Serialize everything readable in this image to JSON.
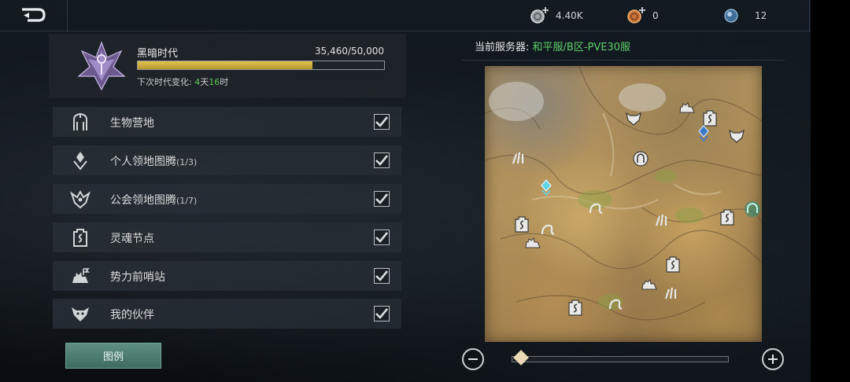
{
  "top_bar": {
    "back_icon": "back-arrow-icon",
    "resources": [
      {
        "name": "silver-coin-icon",
        "value": "4.40K"
      },
      {
        "name": "bronze-coin-icon",
        "value": "0"
      },
      {
        "name": "crystal-orb-icon",
        "value": "12"
      }
    ]
  },
  "era": {
    "name": "黑暗时代",
    "progress_text": "35,460/50,000",
    "progress_fraction": 0.709,
    "change_label": "下次时代变化:",
    "change_days": "4",
    "change_days_unit": "天",
    "change_hours": "16",
    "change_hours_unit": "时",
    "colors": {
      "bar": "#d4b544",
      "highlight": "#5ec95a"
    }
  },
  "filters": [
    {
      "icon": "creature-camp-icon",
      "label": "生物营地",
      "count": "",
      "checked": true
    },
    {
      "icon": "personal-totem-icon",
      "label": "个人领地图腾",
      "count": "(1/3)",
      "checked": true
    },
    {
      "icon": "guild-totem-icon",
      "label": "公会领地图腾",
      "count": "(1/7)",
      "checked": true
    },
    {
      "icon": "soul-node-icon",
      "label": "灵魂节点",
      "count": "",
      "checked": true
    },
    {
      "icon": "outpost-icon",
      "label": "势力前哨站",
      "count": "",
      "checked": true
    },
    {
      "icon": "companion-icon",
      "label": "我的伙伴",
      "count": "",
      "checked": true
    }
  ],
  "legend_button": "图例",
  "server": {
    "label": "当前服务器:",
    "value": "和平服/B区-PVE30服",
    "value_color": "#5fd06a"
  },
  "zoom": {
    "level_fraction": 0.02
  }
}
